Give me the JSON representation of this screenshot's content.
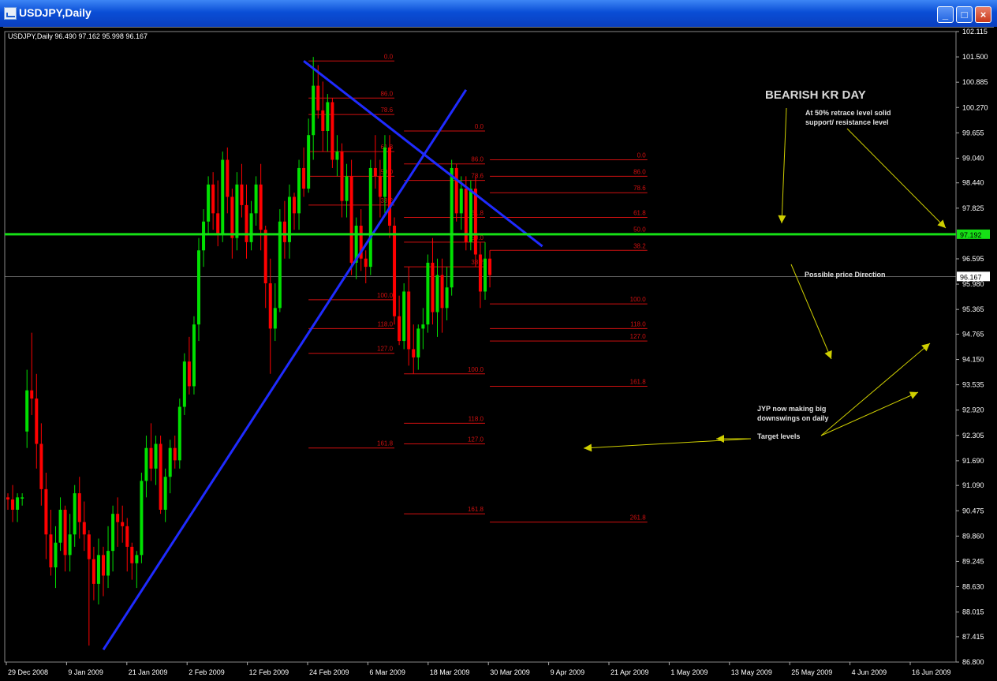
{
  "window": {
    "title": "USDJPY,Daily",
    "buttons": {
      "minimize": "_",
      "maximize": "□",
      "close": "×"
    }
  },
  "header": {
    "symbol_info": "USDJPY,Daily  96.490 97.162 95.998 96.167"
  },
  "colors": {
    "bull": "#00e000",
    "bear": "#ff0000",
    "trendline": "#1f2bff",
    "support": "#16e016",
    "fib": "#d01010",
    "annotation": "#cfcf00",
    "text": "#ffffff"
  },
  "chart_data": {
    "type": "candlestick",
    "title": "USDJPY,Daily",
    "ohlc_header": "96.490 97.162 95.998 96.167",
    "y_ticks": [
      "102.115",
      "101.500",
      "100.885",
      "100.270",
      "99.655",
      "99.040",
      "98.440",
      "97.825",
      "97.192",
      "96.595",
      "95.980",
      "95.365",
      "94.765",
      "94.150",
      "93.535",
      "92.920",
      "92.305",
      "91.690",
      "91.090",
      "90.475",
      "89.860",
      "89.245",
      "88.630",
      "88.015",
      "87.415",
      "86.800"
    ],
    "ylim": [
      86.8,
      102.115
    ],
    "x_ticks": [
      "29 Dec 2008",
      "9 Jan 2009",
      "21 Jan 2009",
      "2 Feb 2009",
      "12 Feb 2009",
      "24 Feb 2009",
      "6 Mar 2009",
      "18 Mar 2009",
      "30 Mar 2009",
      "9 Apr 2009",
      "21 Apr 2009",
      "1 May 2009",
      "13 May 2009",
      "25 May 2009",
      "4 Jun 2009",
      "16 Jun 2009"
    ],
    "current_price": "96.167",
    "support_level": "97.192",
    "candles": [
      [
        90.8,
        90.9,
        90.5,
        90.75
      ],
      [
        90.75,
        91.1,
        90.2,
        90.5
      ],
      [
        90.5,
        90.9,
        90.2,
        90.8
      ],
      [
        90.8,
        90.9,
        90.6,
        90.8
      ],
      [
        92.4,
        93.9,
        92.0,
        93.4
      ],
      [
        93.4,
        94.8,
        92.8,
        93.2
      ],
      [
        93.2,
        93.8,
        91.5,
        92.1
      ],
      [
        92.1,
        92.6,
        90.6,
        91.0
      ],
      [
        91.0,
        91.4,
        89.3,
        89.9
      ],
      [
        89.9,
        90.5,
        88.9,
        89.1
      ],
      [
        89.1,
        90.1,
        88.6,
        89.7
      ],
      [
        89.7,
        90.8,
        89.5,
        90.5
      ],
      [
        90.5,
        90.6,
        89.0,
        89.4
      ],
      [
        89.4,
        90.4,
        89.0,
        89.9
      ],
      [
        89.9,
        91.1,
        89.6,
        90.9
      ],
      [
        90.9,
        91.3,
        89.8,
        90.2
      ],
      [
        90.2,
        90.7,
        89.5,
        89.9
      ],
      [
        89.9,
        90.0,
        87.2,
        89.3
      ],
      [
        89.3,
        89.6,
        88.3,
        88.7
      ],
      [
        88.7,
        89.8,
        88.2,
        89.4
      ],
      [
        89.4,
        89.6,
        88.4,
        88.9
      ],
      [
        88.9,
        90.1,
        88.6,
        89.5
      ],
      [
        89.5,
        90.6,
        89.0,
        90.4
      ],
      [
        90.4,
        90.8,
        89.6,
        90.2
      ],
      [
        90.2,
        90.6,
        89.7,
        90.1
      ],
      [
        90.1,
        90.3,
        89.0,
        89.6
      ],
      [
        89.6,
        89.7,
        88.8,
        89.2
      ],
      [
        89.2,
        89.5,
        88.6,
        89.4
      ],
      [
        89.4,
        91.4,
        89.2,
        91.2
      ],
      [
        91.2,
        92.3,
        90.8,
        92.0
      ],
      [
        92.0,
        92.6,
        91.2,
        91.5
      ],
      [
        91.5,
        92.3,
        91.1,
        92.1
      ],
      [
        92.1,
        92.3,
        90.4,
        90.5
      ],
      [
        90.5,
        91.5,
        90.2,
        91.3
      ],
      [
        91.3,
        92.2,
        90.9,
        92.0
      ],
      [
        92.0,
        92.3,
        91.5,
        91.7
      ],
      [
        91.7,
        93.2,
        91.5,
        93.0
      ],
      [
        93.0,
        94.3,
        92.8,
        94.1
      ],
      [
        94.1,
        94.7,
        93.3,
        93.5
      ],
      [
        93.5,
        95.2,
        93.3,
        95.0
      ],
      [
        95.0,
        97.1,
        94.6,
        96.8
      ],
      [
        96.8,
        97.8,
        96.4,
        97.5
      ],
      [
        97.5,
        98.6,
        97.2,
        98.4
      ],
      [
        98.4,
        98.7,
        97.3,
        97.7
      ],
      [
        97.7,
        98.5,
        96.9,
        97.2
      ],
      [
        97.2,
        99.2,
        97.0,
        99.0
      ],
      [
        99.0,
        99.3,
        97.7,
        98.1
      ],
      [
        98.1,
        98.3,
        96.6,
        97.1
      ],
      [
        97.1,
        98.7,
        96.8,
        98.4
      ],
      [
        98.4,
        98.9,
        97.6,
        97.9
      ],
      [
        97.9,
        98.4,
        96.6,
        97.0
      ],
      [
        97.0,
        98.0,
        96.8,
        97.7
      ],
      [
        97.7,
        98.6,
        97.4,
        98.4
      ],
      [
        98.4,
        98.9,
        96.8,
        97.3
      ],
      [
        97.3,
        97.4,
        95.4,
        96.0
      ],
      [
        96.0,
        96.6,
        93.8,
        94.9
      ],
      [
        94.9,
        96.0,
        94.6,
        95.4
      ],
      [
        95.4,
        97.8,
        95.3,
        97.5
      ],
      [
        97.5,
        98.0,
        96.6,
        97.0
      ],
      [
        97.0,
        98.4,
        96.6,
        98.1
      ],
      [
        98.1,
        98.2,
        97.3,
        97.7
      ],
      [
        97.7,
        99.0,
        97.3,
        98.8
      ],
      [
        98.8,
        99.3,
        98.1,
        98.3
      ],
      [
        98.3,
        100.0,
        98.2,
        99.6
      ],
      [
        99.6,
        101.5,
        99.0,
        100.8
      ],
      [
        100.8,
        101.3,
        100.0,
        100.2
      ],
      [
        100.2,
        100.9,
        99.2,
        99.7
      ],
      [
        99.7,
        100.6,
        99.2,
        100.4
      ],
      [
        100.4,
        100.5,
        98.8,
        99.0
      ],
      [
        99.0,
        99.6,
        98.6,
        99.2
      ],
      [
        99.2,
        99.4,
        97.6,
        98.0
      ],
      [
        98.0,
        98.9,
        97.6,
        98.6
      ],
      [
        98.6,
        99.0,
        96.2,
        96.5
      ],
      [
        96.5,
        97.6,
        96.1,
        97.4
      ],
      [
        97.4,
        97.8,
        96.3,
        96.6
      ],
      [
        96.6,
        96.8,
        96.0,
        96.4
      ],
      [
        96.4,
        99.0,
        96.2,
        98.8
      ],
      [
        98.8,
        99.6,
        98.3,
        98.6
      ],
      [
        98.6,
        99.0,
        97.6,
        98.1
      ],
      [
        98.1,
        99.6,
        97.7,
        99.3
      ],
      [
        99.3,
        99.6,
        97.1,
        97.4
      ],
      [
        97.4,
        97.6,
        95.0,
        95.2
      ],
      [
        95.2,
        95.7,
        94.5,
        94.6
      ],
      [
        94.6,
        96.0,
        94.4,
        95.8
      ],
      [
        95.8,
        96.4,
        94.0,
        94.4
      ],
      [
        94.4,
        95.0,
        93.8,
        94.2
      ],
      [
        94.2,
        95.0,
        93.9,
        94.9
      ],
      [
        94.9,
        95.4,
        94.4,
        95.0
      ],
      [
        95.0,
        96.7,
        94.8,
        96.5
      ],
      [
        96.5,
        97.1,
        95.0,
        95.3
      ],
      [
        95.3,
        96.6,
        94.7,
        96.2
      ],
      [
        96.2,
        96.6,
        94.8,
        95.4
      ],
      [
        95.4,
        96.4,
        95.1,
        95.9
      ],
      [
        95.9,
        99.0,
        95.7,
        98.8
      ],
      [
        98.8,
        98.9,
        97.5,
        97.7
      ],
      [
        97.7,
        98.6,
        97.3,
        98.3
      ],
      [
        98.3,
        98.6,
        96.8,
        97.0
      ],
      [
        97.0,
        98.5,
        96.8,
        98.3
      ],
      [
        98.3,
        98.6,
        96.4,
        96.7
      ],
      [
        96.7,
        97.0,
        95.4,
        95.8
      ],
      [
        95.8,
        97.0,
        95.6,
        96.6
      ],
      [
        96.6,
        96.8,
        95.9,
        96.2
      ]
    ],
    "lines": [
      {
        "kind": "trendline",
        "from": [
          20,
          87.1
        ],
        "to": [
          96,
          100.7
        ]
      },
      {
        "kind": "trendline",
        "from": [
          62,
          101.4
        ],
        "to": [
          112,
          96.9
        ]
      },
      {
        "kind": "support",
        "value": 97.192
      }
    ],
    "fib_sets": [
      {
        "x_from": 63,
        "x_to": 81,
        "levels": [
          [
            "0.0",
            101.4
          ],
          [
            "86.0",
            100.5
          ],
          [
            "78.6",
            100.1
          ],
          [
            "61.8",
            99.2
          ],
          [
            "50.0",
            98.6
          ],
          [
            "38.2",
            97.9
          ],
          [
            "100.0",
            95.6
          ],
          [
            "118.0",
            94.9
          ],
          [
            "127.0",
            94.3
          ],
          [
            "161.8",
            92.0
          ]
        ]
      },
      {
        "x_from": 83,
        "x_to": 100,
        "levels": [
          [
            "0.0",
            99.7
          ],
          [
            "86.0",
            98.9
          ],
          [
            "78.6",
            98.5
          ],
          [
            "61.8",
            97.6
          ],
          [
            "50.0",
            97.0
          ],
          [
            "38.2",
            96.4
          ],
          [
            "100.0",
            93.8
          ],
          [
            "118.0",
            92.6
          ],
          [
            "127.0",
            92.1
          ],
          [
            "161.8",
            90.4
          ]
        ]
      },
      {
        "x_from": 101,
        "x_to": 134,
        "levels": [
          [
            "0.0",
            99.0
          ],
          [
            "86.0",
            98.6
          ],
          [
            "78.6",
            98.2
          ],
          [
            "61.8",
            97.6
          ],
          [
            "50.0",
            97.2
          ],
          [
            "38.2",
            96.8
          ],
          [
            "100.0",
            95.5
          ],
          [
            "118.0",
            94.9
          ],
          [
            "127.0",
            94.6
          ],
          [
            "161.8",
            93.5
          ],
          [
            "261.8",
            90.2
          ]
        ]
      }
    ],
    "annotations": {
      "bearish_kr_day": "BEARISH KR DAY",
      "retrace_note_1": "At 50% retrace level solid",
      "retrace_note_2": "support/ resistance level",
      "possible_direction": "Possible price Direction",
      "jpy_note_1": "JYP now making big",
      "jpy_note_2": "downswings on daily",
      "target_levels": "Target levels"
    }
  }
}
